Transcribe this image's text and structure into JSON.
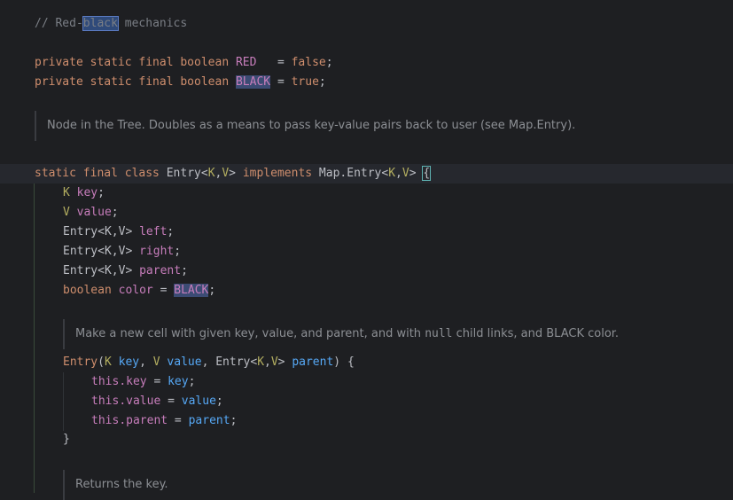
{
  "editor": {
    "comment_line": {
      "prefix": "// Red-",
      "highlight": "black",
      "suffix": " mechanics"
    },
    "red_line": {
      "mods": "private static final boolean",
      "name": "RED",
      "eq": "   = ",
      "val": "false",
      "semi": ";"
    },
    "black_line": {
      "mods": "private static final boolean",
      "name": "BLACK",
      "eq": " = ",
      "val": "true",
      "semi": ";"
    },
    "doc1": "Node in the Tree. Doubles as a means to pass key-value pairs back to user (see Map.Entry).",
    "class_line": {
      "mods": "static final class",
      "name": " Entry<",
      "k": "K",
      "comma": ",",
      "v": "V",
      "close": "> ",
      "impl": "implements",
      "map": " Map.Entry<",
      "k2": "K",
      "comma2": ",",
      "v2": "V",
      "close2": "> ",
      "brace": "{"
    },
    "fields": [
      {
        "type": "K",
        "name": "key"
      },
      {
        "type": "V",
        "name": "value"
      },
      {
        "type": "Entry<K,V>",
        "name": "left"
      },
      {
        "type": "Entry<K,V>",
        "name": "right"
      },
      {
        "type": "Entry<K,V>",
        "name": "parent"
      }
    ],
    "color_line": {
      "type": "boolean",
      "name": "color",
      "eq": " = ",
      "val": "BLACK",
      "semi": ";"
    },
    "doc2": {
      "a": "Make a new cell with given key, value, and parent, and with ",
      "mono": "null",
      "b": " child links, and BLACK color."
    },
    "ctor_sig": "Entry",
    "ctor_params": "(K key, V value, Entry<K,V> parent) {",
    "ctor_body": [
      {
        "this": "this",
        "field": ".key",
        "eq": " = ",
        "val": "key",
        "semi": ";"
      },
      {
        "this": "this",
        "field": ".value",
        "eq": " = ",
        "val": "value",
        "semi": ";"
      },
      {
        "this": "this",
        "field": ".parent",
        "eq": " = ",
        "val": "parent",
        "semi": ";"
      }
    ],
    "ctor_close": "}",
    "doc3": "Returns the key."
  },
  "colors": {
    "background": "#1e1f22",
    "keyword": "#cf8e6d",
    "type_param": "#b3ae60",
    "field": "#c77dbb",
    "param": "#56a8f5",
    "comment": "#7a7e85"
  }
}
